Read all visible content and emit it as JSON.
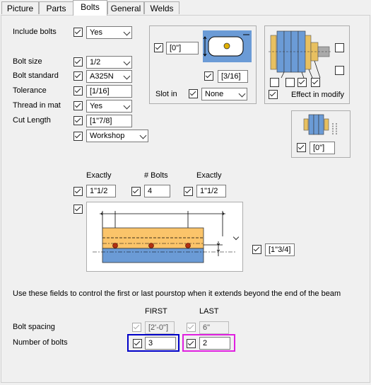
{
  "tabs": [
    "Picture",
    "Parts",
    "Bolts",
    "General",
    "Welds"
  ],
  "include_bolts": {
    "label": "Include bolts",
    "value": "Yes"
  },
  "bolt_size": {
    "label": "Bolt size",
    "value": "1/2"
  },
  "bolt_standard": {
    "label": "Bolt standard",
    "value": "A325N"
  },
  "tolerance": {
    "label": "Tolerance",
    "value": "[1/16]"
  },
  "thread_in_mat": {
    "label": "Thread in mat",
    "value": "Yes"
  },
  "cut_length": {
    "label": "Cut Length",
    "value": "[1\"7/8]"
  },
  "workshop": {
    "value": "Workshop"
  },
  "slot": {
    "offset": "[0\"]",
    "width": "[3/16]",
    "slot_in_label": "Slot in",
    "slot_in_value": "None"
  },
  "effect_in_modify": "Effect in modify",
  "washer_offset": "[0\"]",
  "layout": {
    "exactly_left_label": "Exactly",
    "num_bolts_label": "# Bolts",
    "exactly_right_label": "Exactly",
    "exactly_left": "1\"1/2",
    "num_bolts": "4",
    "exactly_right": "1\"1/2",
    "edge_distance": "[1\"3/4]"
  },
  "pourstop": {
    "note": "Use these fields to control the first or last pourstop when it extends beyond the end of the beam",
    "first_label": "FIRST",
    "last_label": "LAST",
    "bolt_spacing_label": "Bolt spacing",
    "number_of_bolts_label": "Number of bolts",
    "first_spacing": "[2'-0\"]",
    "last_spacing": "6\"",
    "first_count": "3",
    "last_count": "2"
  },
  "colors": {
    "accent_blue": "#0000c8",
    "accent_magenta": "#e020e0",
    "plate_orange": "#fbc46a",
    "beam_blue": "#6b9bd6"
  }
}
